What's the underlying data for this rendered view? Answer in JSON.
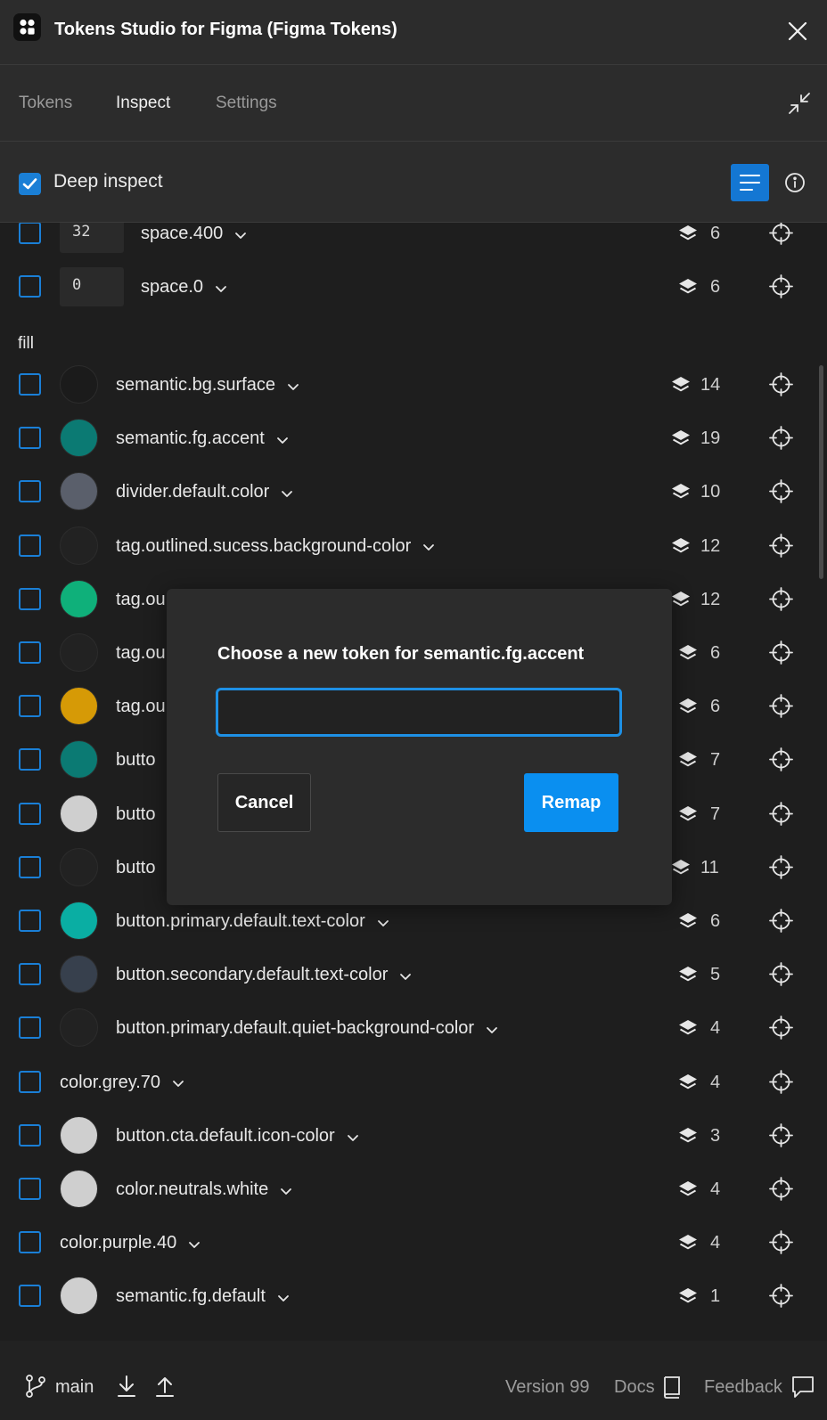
{
  "app": {
    "title": "Tokens Studio for Figma (Figma Tokens)",
    "icons": {
      "logo": "tokens-studio-logo",
      "close": "close-icon"
    }
  },
  "tabs": [
    {
      "label": "Tokens",
      "active": false
    },
    {
      "label": "Inspect",
      "active": true
    },
    {
      "label": "Settings",
      "active": false
    }
  ],
  "toolbar": {
    "deep_inspect_label": "Deep inspect",
    "deep_inspect_checked": true,
    "icons": {
      "list_view": "list-view-icon",
      "info": "info-icon",
      "collapse": "collapse-icon"
    }
  },
  "spacing_tokens": [
    {
      "value": "32",
      "name": "space.400",
      "count": "6"
    },
    {
      "value": "0",
      "name": "space.0",
      "count": "6"
    }
  ],
  "fill_group": {
    "label": "fill",
    "tokens": [
      {
        "name": "semantic.bg.surface",
        "count": "14",
        "swatch": "#1b1b1b"
      },
      {
        "name": "semantic.fg.accent",
        "count": "19",
        "swatch": "#0b7a73"
      },
      {
        "name": "divider.default.color",
        "count": "10",
        "swatch": "#5a5f6b"
      },
      {
        "name": "tag.outlined.sucess.background-color",
        "count": "12",
        "swatch": "#222222"
      },
      {
        "name": "tag.ou",
        "count": "12",
        "swatch": "#0fb07a"
      },
      {
        "name": "tag.ou",
        "count": "6",
        "swatch": "#222222"
      },
      {
        "name": "tag.ou",
        "count": "6",
        "swatch": "#d69a06"
      },
      {
        "name": "butto",
        "count": "7",
        "swatch": "#0b7a73"
      },
      {
        "name": "butto",
        "count": "7",
        "swatch": "#cfcfcf"
      },
      {
        "name": "butto",
        "count": "11",
        "swatch": "#222222"
      },
      {
        "name": "button.primary.default.text-color",
        "count": "6",
        "swatch": "#0aaea3"
      },
      {
        "name": "button.secondary.default.text-color",
        "count": "5",
        "swatch": "#37404d"
      },
      {
        "name": "button.primary.default.quiet-background-color",
        "count": "4",
        "swatch": "#222222"
      },
      {
        "name": "color.grey.70",
        "count": "4",
        "swatch": null
      },
      {
        "name": "button.cta.default.icon-color",
        "count": "3",
        "swatch": "#cfcfcf"
      },
      {
        "name": "color.neutrals.white",
        "count": "4",
        "swatch": "#cfcfcf"
      },
      {
        "name": "color.purple.40",
        "count": "4",
        "swatch": null
      },
      {
        "name": "semantic.fg.default",
        "count": "1",
        "swatch": "#cfcfcf"
      }
    ]
  },
  "modal": {
    "title": "Choose a new token for semantic.fg.accent",
    "input_value": "",
    "cancel_label": "Cancel",
    "remap_label": "Remap"
  },
  "footer": {
    "branch": "main",
    "version": "Version 99",
    "docs": "Docs",
    "feedback": "Feedback",
    "icons": {
      "branch": "git-branch-icon",
      "pull": "pull-icon",
      "push": "push-icon",
      "docs": "book-icon",
      "feedback": "chat-icon"
    }
  },
  "colors": {
    "accent": "#1a7fd6",
    "remap": "#0a8ff0",
    "background": "#1e1e1e",
    "panel": "#2c2c2c"
  }
}
